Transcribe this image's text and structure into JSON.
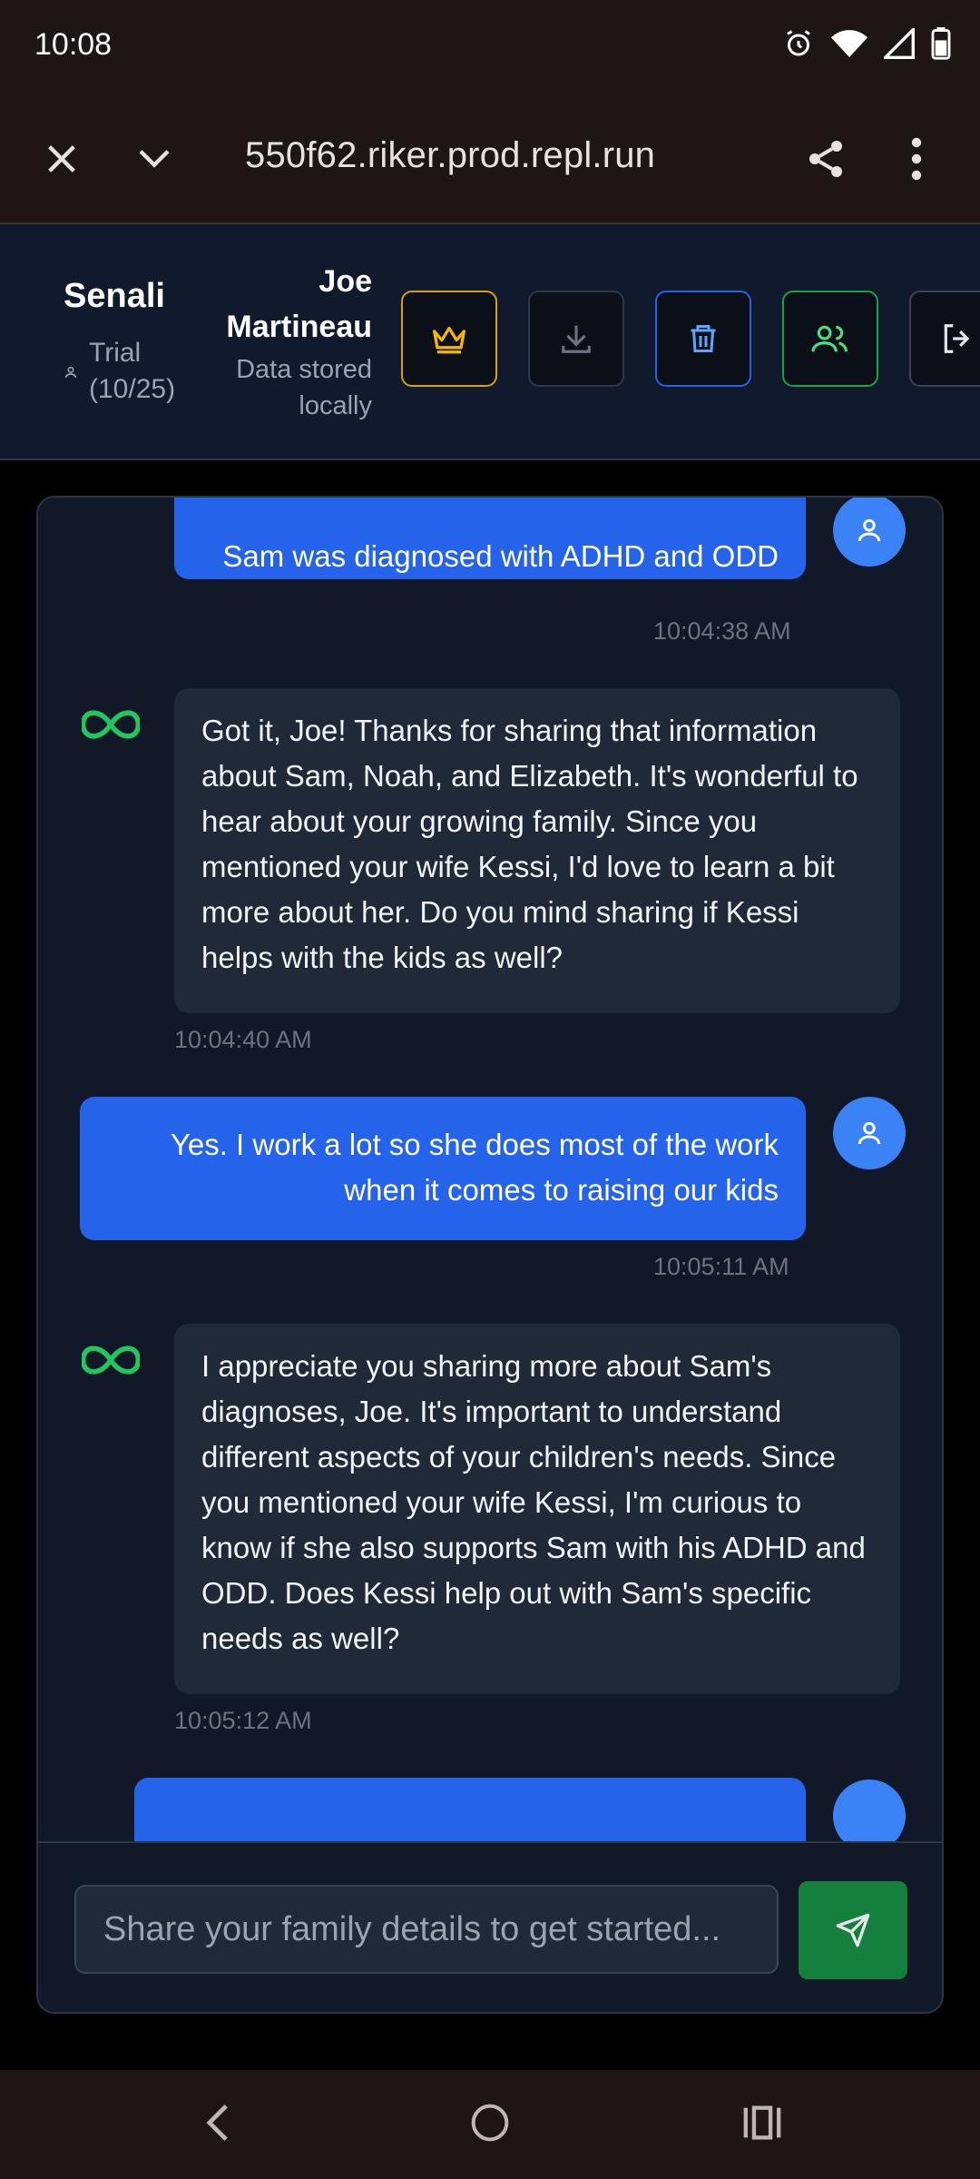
{
  "status_bar": {
    "time": "10:08"
  },
  "browser": {
    "url": "550f62.riker.prod.repl.run"
  },
  "header": {
    "brand": "Senali",
    "trial_label": "Trial",
    "trial_count": "(10/25)",
    "user_first": "Joe",
    "user_last": "Martineau",
    "storage_line1": "Data stored",
    "storage_line2": "locally"
  },
  "messages": [
    {
      "role": "user",
      "text": "Sam was diagnosed with ADHD and ODD",
      "time": "10:04:38 AM"
    },
    {
      "role": "bot",
      "text": "Got it, Joe! Thanks for sharing that information about Sam, Noah, and Elizabeth. It's wonderful to hear about your growing family. Since you mentioned your wife Kessi, I'd love to learn a bit more about her. Do you mind sharing if Kessi helps with the kids as well?",
      "time": "10:04:40 AM"
    },
    {
      "role": "user",
      "text": "Yes.  I work a lot so she does most of the work when it comes to raising our kids",
      "time": "10:05:11 AM"
    },
    {
      "role": "bot",
      "text": "I appreciate you sharing more about Sam's diagnoses, Joe. It's important to understand different aspects of your children's needs. Since you mentioned your wife Kessi, I'm curious to know if she also supports Sam with his ADHD and ODD. Does Kessi help out with Sam's specific needs as well?",
      "time": "10:05:12 AM"
    }
  ],
  "input": {
    "placeholder": "Share your family details to get started..."
  },
  "colors": {
    "user_bubble": "#2563eb",
    "bot_bubble": "#1f2937",
    "send": "#15803d",
    "crown": "#f5b800",
    "infinity": "#22c55e"
  }
}
